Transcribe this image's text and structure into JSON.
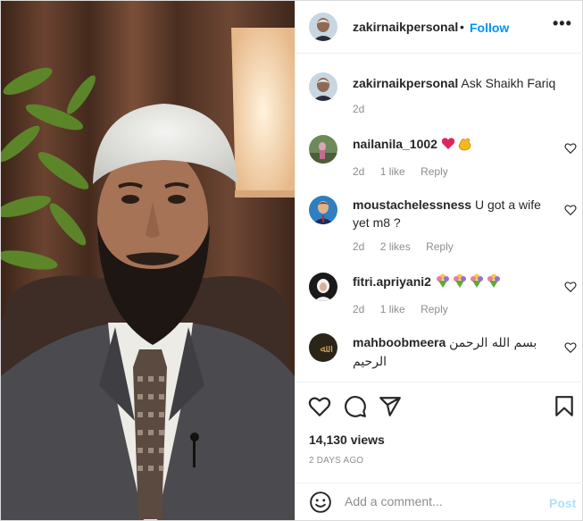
{
  "post": {
    "username": "zakirnaikpersonal",
    "dot": "•",
    "follow_label": "Follow",
    "more_label": "•••",
    "caption": {
      "username": "zakirnaikpersonal",
      "text": "Ask Shaikh Fariq",
      "time": "2d"
    },
    "comments": [
      {
        "username": "nailanila_1002",
        "text": "",
        "emoji": "heart-and-clapping-hands-emoji",
        "time": "2d",
        "likes": "1 like",
        "reply": "Reply"
      },
      {
        "username": "moustachelessness",
        "text": "U got a wife yet m8 ?",
        "time": "2d",
        "likes": "2 likes",
        "reply": "Reply"
      },
      {
        "username": "fitri.apriyani2",
        "text": "",
        "emoji": "four-flower-bouquet-emoji",
        "time": "2d",
        "likes": "1 like",
        "reply": "Reply"
      },
      {
        "username": "mahboobmeera",
        "text": "بسم الله الرحمن الرحيم"
      }
    ],
    "views": "14,130 views",
    "posted": "2 DAYS AGO",
    "add_comment": {
      "placeholder": "Add a comment...",
      "post_label": "Post"
    },
    "icons": {
      "like": "heart-icon",
      "comment": "comment-icon",
      "share": "paper-plane-icon",
      "save": "bookmark-icon",
      "emoji": "smiley-icon"
    },
    "colors": {
      "accent": "#0095f6",
      "post_disabled": "#b2dffc",
      "muted": "#8e8e8e"
    }
  }
}
